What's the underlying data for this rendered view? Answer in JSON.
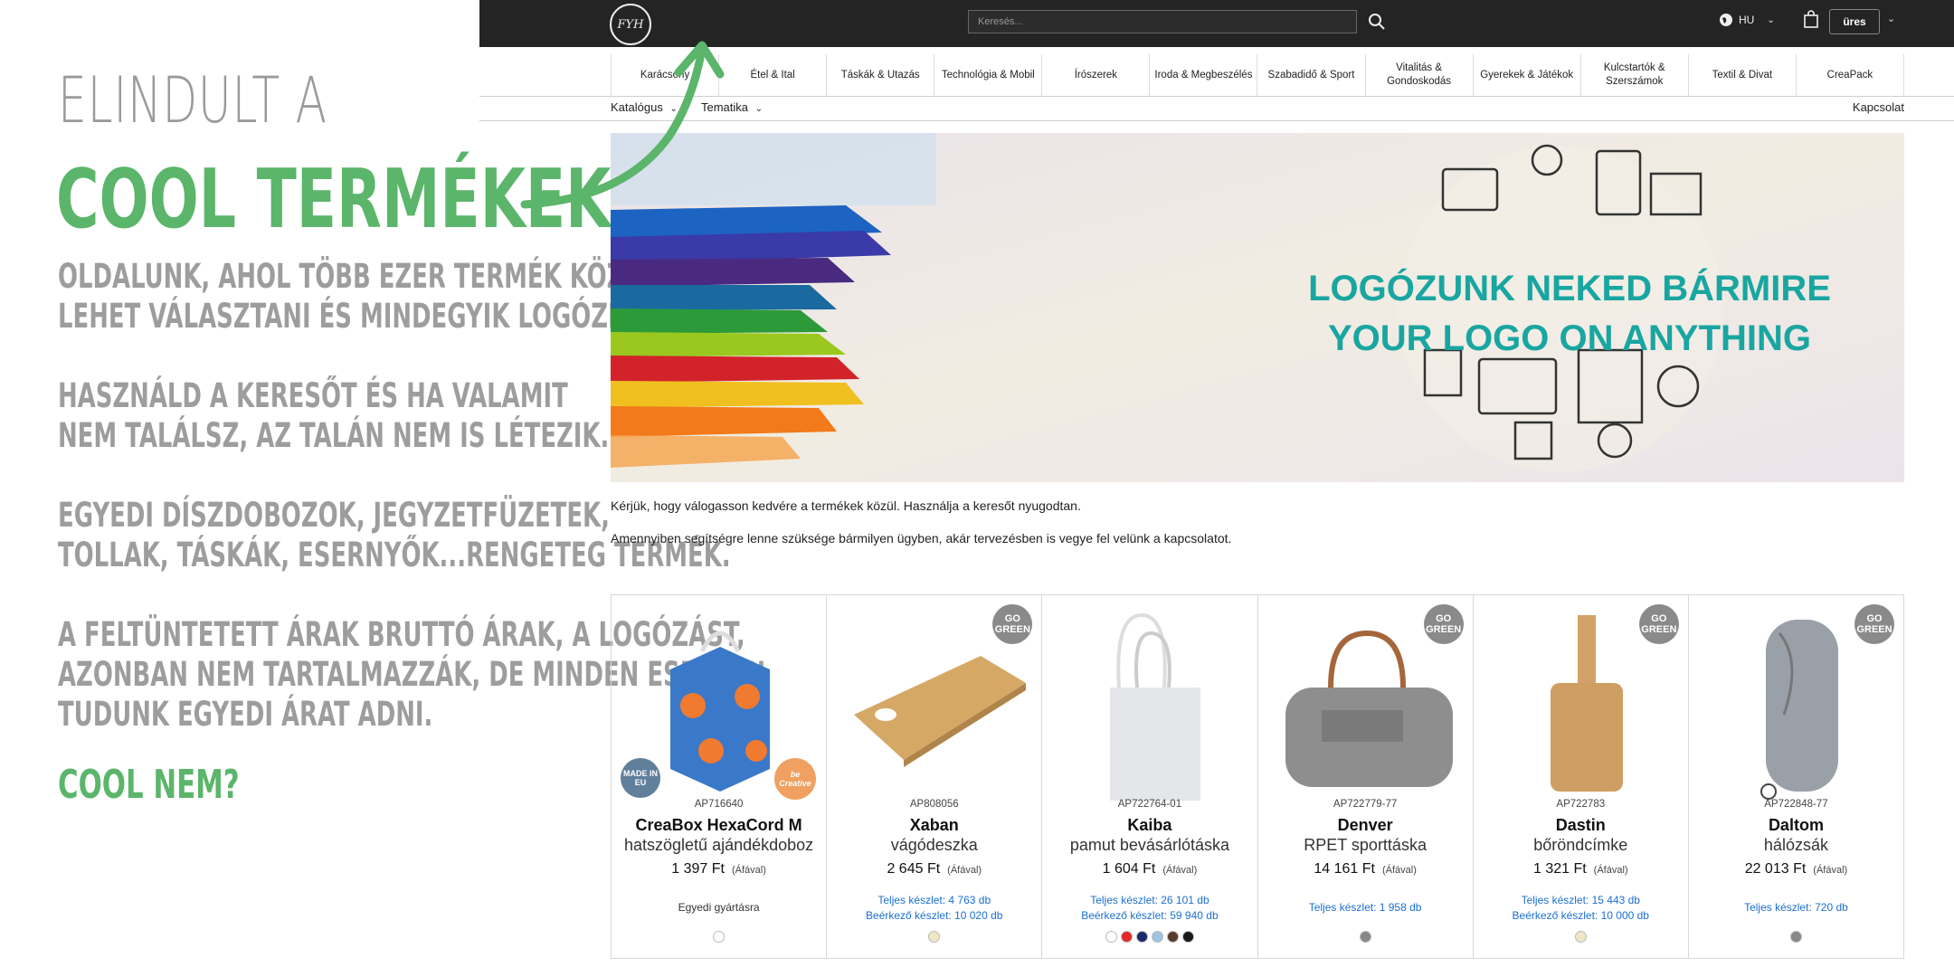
{
  "promo": {
    "line1": "ELINDULT A",
    "line2": "COOL TERMÉKEK",
    "p1": "OLDALUNK, AHOL TÖBB EZER TERMÉK KÖZÜL\nLEHET VÁLASZTANI ÉS MINDEGYIK LOGÓZHATÓ.",
    "p2": "HASZNÁLD A KERESŐT ÉS HA VALAMIT\nNEM TALÁLSZ, AZ TALÁN NEM IS LÉTEZIK.",
    "p3": "EGYEDI DÍSZDOBOZOK, JEGYZETFÜZETEK,\nTOLLAK, TÁSKÁK, ESERNYŐK...RENGETEG TERMÉK.",
    "p4": "A FELTÜNTETETT ÁRAK BRUTTÓ ÁRAK, A LOGÓZÁST,\nAZONBAN NEM TARTALMAZZÁK, DE MINDEN ESETBEN\nTUDUNK EGYEDI ÁRAT ADNI.",
    "cool": "COOL NEM?",
    "accent": "#5bb56a"
  },
  "header": {
    "logo_text": "FYH",
    "search_placeholder": "Keresés...",
    "lang": "HU",
    "cart_label": "üres"
  },
  "categories": [
    "Karácsony",
    "Étel & Ital",
    "Táskák & Utazás",
    "Technológia & Mobil",
    "Írószerek",
    "Iroda & Megbeszélés",
    "Szabadidő & Sport",
    "Vitalitás & Gondoskodás",
    "Gyerekek & Játékok",
    "Kulcstartók & Szerszámok",
    "Textil & Divat",
    "CreaPack"
  ],
  "subnav": {
    "catalog": "Katalógus",
    "thematic": "Tematika",
    "contact": "Kapcsolat"
  },
  "banner": {
    "line1": "LOGÓZUNK NEKED BÁRMIRE",
    "line2": "YOUR LOGO ON ANYTHING"
  },
  "intro": {
    "line1": "Kérjük, hogy válogasson kedvére a termékek közül. Használja a keresőt nyugodtan.",
    "line2": "Amennyiben segítségre lenne szüksége bármilyen ügyben, akár tervezésben is vegye fel velünk a kapcsolatot."
  },
  "green_badge": {
    "top": "GO",
    "bottom": "GREEN"
  },
  "made_in_eu": "MADE IN EU",
  "be_creative": "be Creative",
  "products": [
    {
      "code": "AP716640",
      "name": "CreaBox HexaCord M",
      "desc": "hatszögletű ajándékdoboz",
      "price": "1 397 Ft",
      "vat": "(Áfával)",
      "custom": "Egyedi gyártásra",
      "stock_total": "",
      "stock_incoming": "",
      "swatches": [
        "#ffffff"
      ],
      "green": false
    },
    {
      "code": "AP808056",
      "name": "Xaban",
      "desc": "vágódeszka",
      "price": "2 645 Ft",
      "vat": "(Áfával)",
      "custom": "",
      "stock_total": "Teljes készlet: 4 763 db",
      "stock_incoming": "Beérkező készlet: 10 020 db",
      "swatches": [
        "#efe6c4"
      ],
      "green": true
    },
    {
      "code": "AP722764-01",
      "name": "Kaiba",
      "desc": "pamut bevásárlótáska",
      "price": "1 604 Ft",
      "vat": "(Áfával)",
      "custom": "",
      "stock_total": "Teljes készlet: 26 101 db",
      "stock_incoming": "Beérkező készlet: 59 940 db",
      "swatches": [
        "#ffffff",
        "#e02b2b",
        "#1b2a6b",
        "#9cc4e4",
        "#5a3a2a",
        "#1a1a1a"
      ],
      "green": false
    },
    {
      "code": "AP722779-77",
      "name": "Denver",
      "desc": "RPET sporttáska",
      "price": "14 161 Ft",
      "vat": "(Áfával)",
      "custom": "",
      "stock_total": "Teljes készlet: 1 958 db",
      "stock_incoming": "",
      "swatches": [
        "#888888"
      ],
      "green": true
    },
    {
      "code": "AP722783",
      "name": "Dastin",
      "desc": "bőröndcímke",
      "price": "1 321 Ft",
      "vat": "(Áfával)",
      "custom": "",
      "stock_total": "Teljes készlet: 15 443 db",
      "stock_incoming": "Beérkező készlet: 10 000 db",
      "swatches": [
        "#efe6c4"
      ],
      "green": true
    },
    {
      "code": "AP722848-77",
      "name": "Daltom",
      "desc": "hálózsák",
      "price": "22 013 Ft",
      "vat": "(Áfával)",
      "custom": "",
      "stock_total": "Teljes készlet: 720 db",
      "stock_incoming": "",
      "swatches": [
        "#888888"
      ],
      "green": true
    }
  ]
}
